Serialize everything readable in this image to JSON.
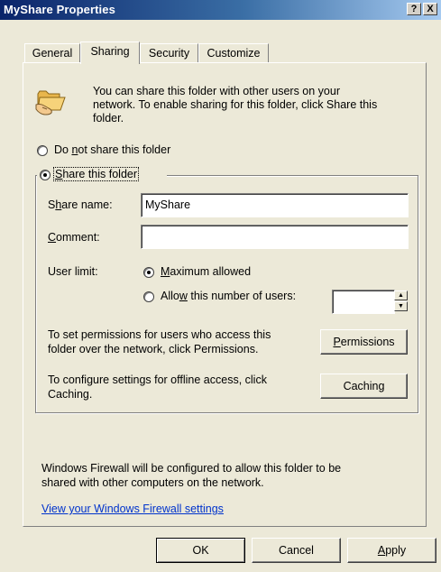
{
  "window": {
    "title": "MyShare Properties",
    "help_button": "?",
    "close_button": "X"
  },
  "tabs": [
    {
      "label": "General"
    },
    {
      "label": "Sharing",
      "active": true
    },
    {
      "label": "Security"
    },
    {
      "label": "Customize"
    }
  ],
  "intro": {
    "icon": "shared-folder-icon",
    "text_line1": "You can share this folder with other users on your",
    "text_line2": "network.  To enable sharing for this folder, click Share this",
    "text_line3": "folder."
  },
  "options": {
    "do_not_share": {
      "pre": "Do ",
      "acc": "n",
      "post": "ot share this folder",
      "selected": false
    },
    "share": {
      "acc": "S",
      "post": "hare this folder",
      "selected": true
    }
  },
  "share_name": {
    "pre": "S",
    "acc": "h",
    "post": "are name:",
    "value": "MyShare"
  },
  "comment": {
    "acc": "C",
    "post": "omment:",
    "value": ""
  },
  "user_limit": {
    "label": "User limit:",
    "max_allowed": {
      "acc": "M",
      "post": "aximum allowed",
      "selected": true
    },
    "allow_number": {
      "pre": "Allo",
      "acc": "w",
      "post": " this number of users:",
      "selected": false
    },
    "spinner_value": ""
  },
  "permissions": {
    "text_line1": "To set permissions for users who access this",
    "text_line2": "folder over the network, click Permissions.",
    "button": {
      "acc": "P",
      "post": "ermissions"
    }
  },
  "caching": {
    "text_line1": "To configure settings for offline access, click",
    "text_line2": "Caching.",
    "button": {
      "pre": "Cachin",
      "acc": "g",
      "post": ""
    }
  },
  "firewall": {
    "text_line1": "Windows Firewall will be configured to allow this folder to be",
    "text_line2": "shared with other computers on the network.",
    "link": "View your Windows Firewall settings"
  },
  "footer": {
    "ok": "OK",
    "cancel": "Cancel",
    "apply_acc": "A",
    "apply_post": "pply"
  },
  "colors": {
    "titlebar_start": "#0a246a",
    "titlebar_end": "#a6caf0",
    "dialog_bg": "#ece9d8",
    "link": "#0033cc"
  }
}
